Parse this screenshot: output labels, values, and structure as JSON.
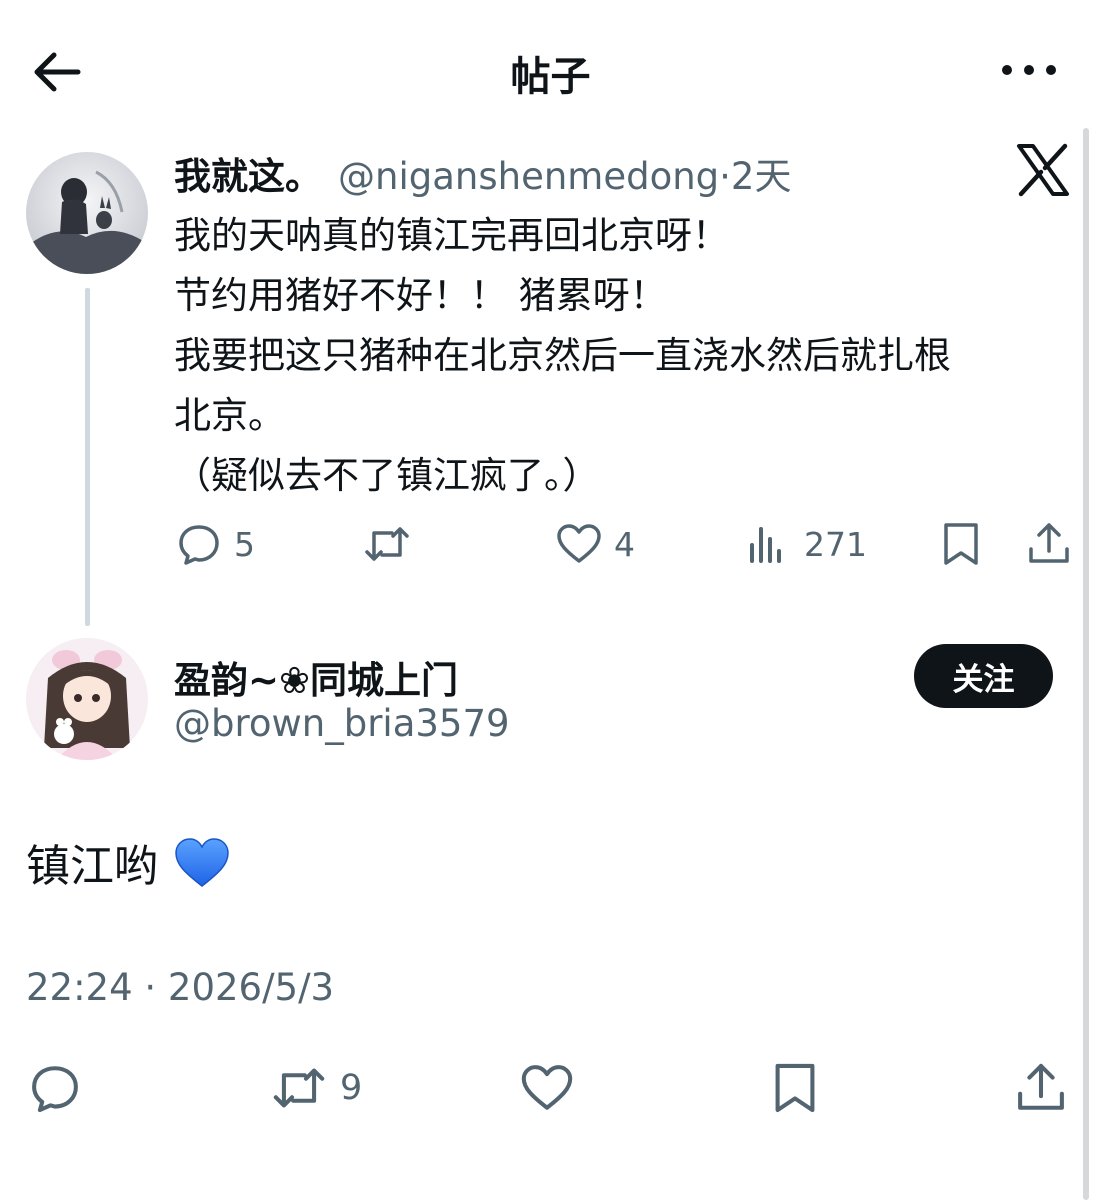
{
  "header": {
    "title": "帖子",
    "back_icon": "arrow-left-icon",
    "more_icon": "more-horizontal-icon"
  },
  "post": {
    "author_name": "我就这。",
    "author_handle": "@niganshenmedong",
    "time_ago": "·2天",
    "platform_icon": "x-logo-icon",
    "lines": [
      "我的天呐真的镇江完再回北京呀！",
      "节约用猪好不好！！ 猪累呀！",
      "我要把这只猪种在北京然后一直浇水然后就扎根",
      "北京。",
      "（疑似去不了镇江疯了。）"
    ],
    "stats": {
      "replies": "5",
      "retweets": "",
      "likes": "4",
      "views": "271"
    }
  },
  "reply": {
    "author_name": "盈韵~❀同城上门",
    "author_handle": "@brown_bria3579",
    "follow_label": "关注",
    "text": "镇江哟",
    "emoji": "blue-heart-icon",
    "timestamp": "22:24 · 2026/5/3",
    "stats": {
      "replies": "",
      "retweets": "9",
      "likes": "",
      "bookmark": "",
      "share": ""
    }
  },
  "colors": {
    "text": "#0f1419",
    "secondary": "#536471",
    "thread_line": "#cfd9de",
    "follow_bg": "#0f1419",
    "heart_blue": "#2f7bf6"
  }
}
